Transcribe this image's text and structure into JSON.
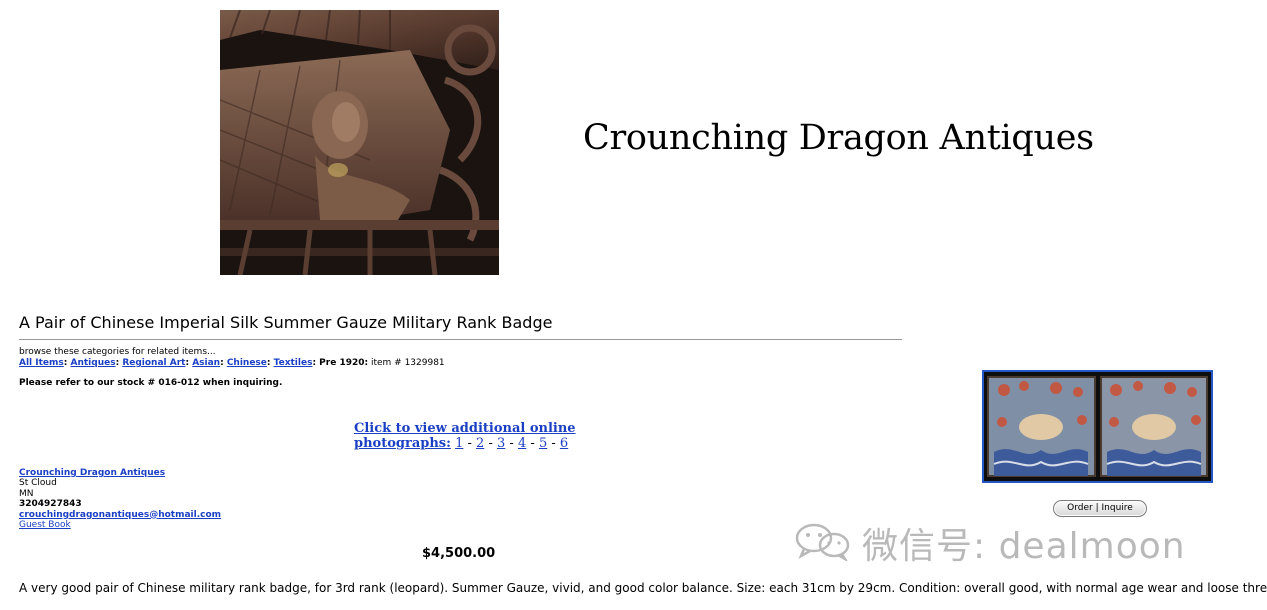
{
  "header": {
    "title": "Crounching Dragon Antiques",
    "image_icon": "bronze-carving-photo"
  },
  "item": {
    "title": "A Pair of Chinese Imperial Silk Summer Gauze Military Rank Badge",
    "browse_intro": "browse these categories for related items...",
    "breadcrumb": [
      "All Items",
      "Antiques",
      "Regional Art",
      "Asian",
      "Chinese",
      "Textiles"
    ],
    "breadcrumb_current": "Pre 1920:",
    "item_number": "item # 1329981",
    "stock_notice": "Please refer to our stock # 016-012 when inquiring.",
    "price": "$4,500.00",
    "description": "A very good pair of Chinese military rank badge, for 3rd rank (leopard). Summer Gauze, vivid, and good color balance. Size: each 31cm by 29cm. Condition: overall good, with normal age wear and loose thread."
  },
  "photos": {
    "line1": "Click to view additional online",
    "line2": "photographs:",
    "pages": [
      "1",
      "2",
      "3",
      "4",
      "5",
      "6"
    ]
  },
  "seller": {
    "name": "Crounching Dragon Antiques",
    "city": "St Cloud",
    "state": "MN",
    "phone": "3204927843",
    "email": "crouchingdragonantiques@hotmail.com",
    "guestbook": "Guest Book"
  },
  "actions": {
    "order": "Order",
    "divider": "|",
    "inquire": "Inquire"
  },
  "watermark": {
    "text": "微信号: dealmoon",
    "icon": "wechat-icon"
  },
  "colors": {
    "link": "#1a3fc4",
    "thumb_border": "#2557c7",
    "watermark": "#b9b9b9"
  }
}
